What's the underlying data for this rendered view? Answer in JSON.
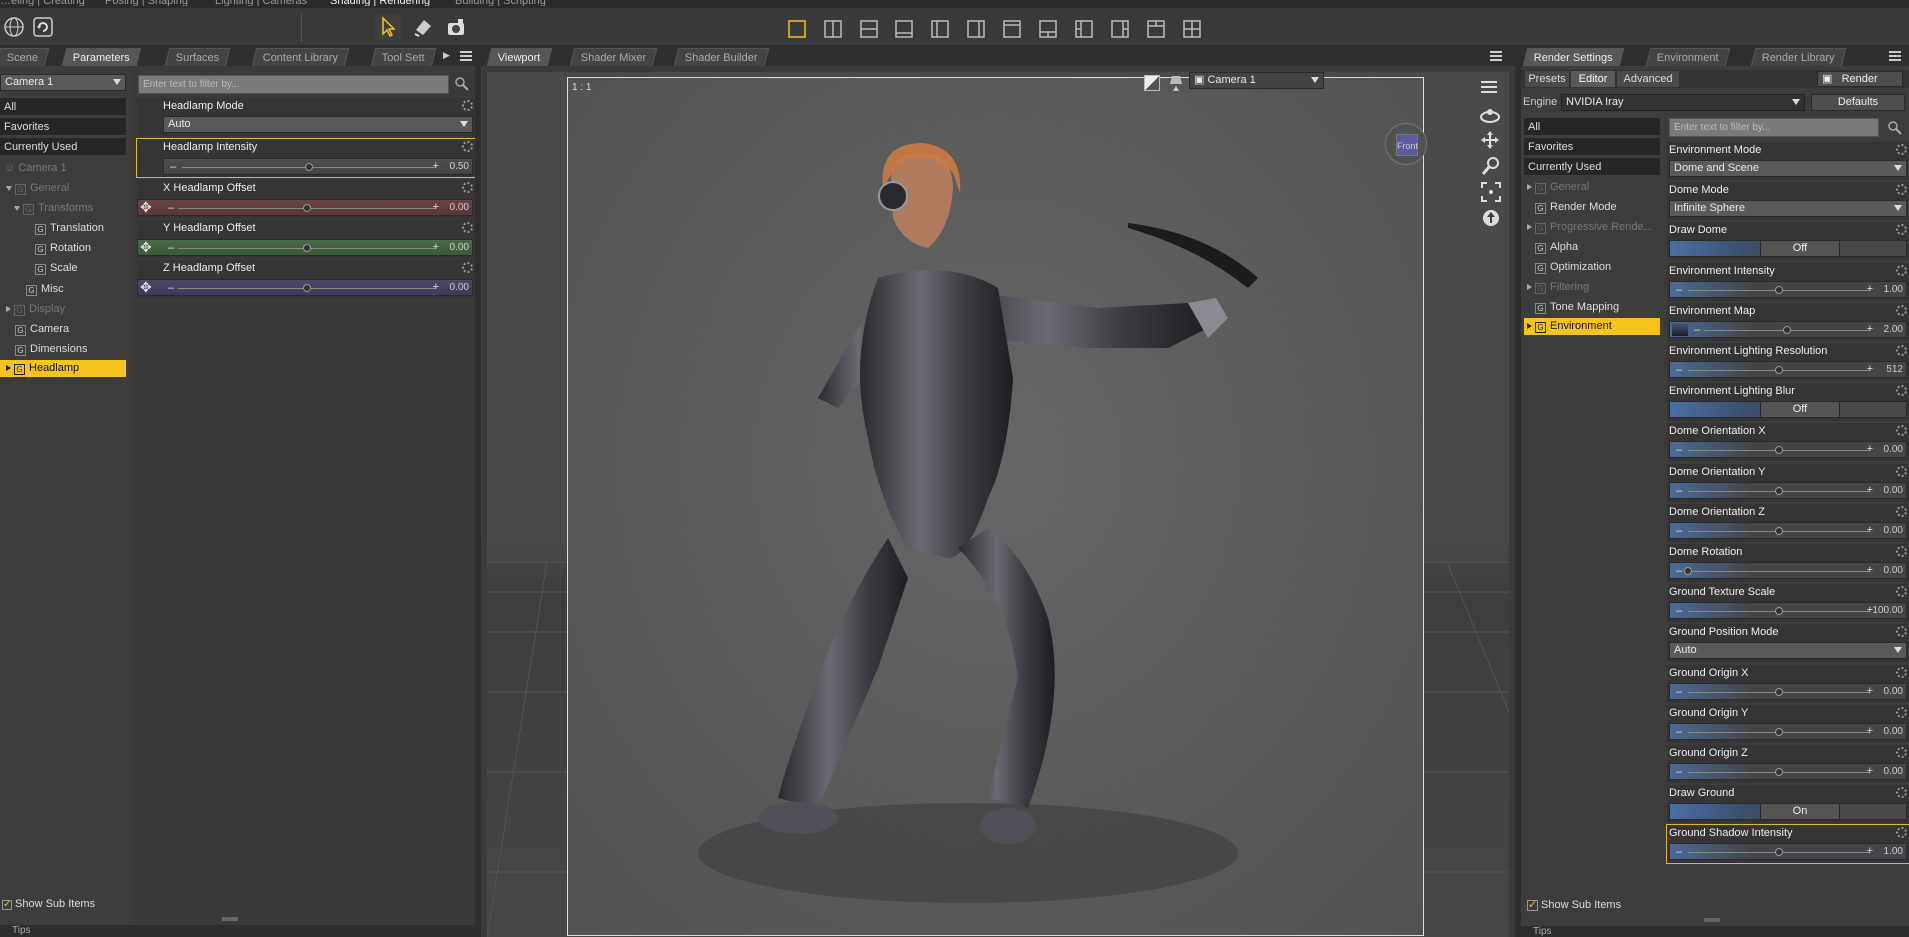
{
  "top_tabs": [
    "…eling | Creating",
    "Posing | Shaping",
    "Lighting | Cameras",
    "Shading | Rendering",
    "Building | Scripting"
  ],
  "left_tabs": [
    "Scene",
    "Parameters",
    "Surfaces",
    "Content Library",
    "Tool Sett"
  ],
  "camera_select": "Camera 1",
  "left_list": [
    "All",
    "Favorites",
    "Currently Used"
  ],
  "tree": [
    {
      "label": "Camera 1",
      "dim": true
    },
    {
      "label": "General",
      "dim": true
    },
    {
      "label": "Transforms",
      "dim": true
    },
    {
      "label": "Translation"
    },
    {
      "label": "Rotation"
    },
    {
      "label": "Scale"
    },
    {
      "label": "Misc"
    },
    {
      "label": "Display",
      "dim": true
    },
    {
      "label": "Camera"
    },
    {
      "label": "Dimensions"
    },
    {
      "label": "Headlamp",
      "selected": true
    }
  ],
  "left_filter_placeholder": "Enter text to filter by...",
  "params": {
    "headlamp_mode": {
      "label": "Headlamp Mode",
      "value": "Auto"
    },
    "headlamp_intensity": {
      "label": "Headlamp Intensity",
      "value": "0.50",
      "level": 0.5
    },
    "x_offset": {
      "label": "X Headlamp Offset",
      "value": "0.00",
      "level": 0.5,
      "color": "#7a4a4a"
    },
    "y_offset": {
      "label": "Y Headlamp Offset",
      "value": "0.00",
      "level": 0.5,
      "color": "#4a6a4a"
    },
    "z_offset": {
      "label": "Z Headlamp Offset",
      "value": "0.00",
      "level": 0.5,
      "color": "#4a4a6a"
    }
  },
  "show_sub_items": "Show Sub Items",
  "tips": "Tips",
  "center_tabs": [
    "Viewport",
    "Shader Mixer",
    "Shader Builder"
  ],
  "viewport": {
    "ratio": "1 : 1",
    "camera": "Camera 1",
    "cube_label": "Front"
  },
  "right_tabs": [
    "Render Settings",
    "Environment",
    "Render Library"
  ],
  "right_subtabs": [
    "Presets",
    "Editor",
    "Advanced"
  ],
  "render_button": "Render",
  "engine_label": "Engine :",
  "engine": "NVIDIA Iray",
  "defaults_button": "Defaults",
  "right_list": [
    "All",
    "Favorites",
    "Currently Used"
  ],
  "right_tree": [
    {
      "label": "General",
      "dim": true,
      "tri": true
    },
    {
      "label": "Render Mode"
    },
    {
      "label": "Progressive Rende...",
      "dim": true,
      "tri": true
    },
    {
      "label": "Alpha"
    },
    {
      "label": "Optimization"
    },
    {
      "label": "Filtering",
      "dim": true,
      "tri": true
    },
    {
      "label": "Tone Mapping"
    },
    {
      "label": "Environment",
      "selected": true,
      "tri": true
    }
  ],
  "right_filter_placeholder": "Enter text to filter by...",
  "env_props": [
    {
      "label": "Environment Mode",
      "type": "dd",
      "value": "Dome and Scene"
    },
    {
      "label": "Dome Mode",
      "type": "dd",
      "value": "Infinite Sphere"
    },
    {
      "label": "Draw Dome",
      "type": "toggle",
      "value": "Off"
    },
    {
      "label": "Environment Intensity",
      "type": "slider",
      "value": "1.00",
      "level": 0.5
    },
    {
      "label": "Environment Map",
      "type": "map",
      "value": "2.00",
      "level": 0.5
    },
    {
      "label": "Environment Lighting Resolution",
      "type": "slider",
      "value": "512",
      "level": 0.5
    },
    {
      "label": "Environment Lighting Blur",
      "type": "toggle",
      "value": "Off"
    },
    {
      "label": "Dome Orientation X",
      "type": "slider",
      "value": "0.00",
      "level": 0.5
    },
    {
      "label": "Dome Orientation Y",
      "type": "slider",
      "value": "0.00",
      "level": 0.5
    },
    {
      "label": "Dome Orientation Z",
      "type": "slider",
      "value": "0.00",
      "level": 0.5
    },
    {
      "label": "Dome Rotation",
      "type": "slider",
      "value": "0.00",
      "level": 0.0
    },
    {
      "label": "Ground Texture Scale",
      "type": "slider",
      "value": "100.00",
      "level": 0.5
    },
    {
      "label": "Ground Position Mode",
      "type": "dd",
      "value": "Auto"
    },
    {
      "label": "Ground Origin X",
      "type": "slider",
      "value": "0.00",
      "level": 0.5
    },
    {
      "label": "Ground Origin Y",
      "type": "slider",
      "value": "0.00",
      "level": 0.5
    },
    {
      "label": "Ground Origin Z",
      "type": "slider",
      "value": "0.00",
      "level": 0.5
    },
    {
      "label": "Draw Ground",
      "type": "toggle",
      "value": "On"
    },
    {
      "label": "Ground Shadow Intensity",
      "type": "slider",
      "value": "1.00",
      "level": 0.5,
      "hl": true
    }
  ],
  "colors": {
    "accent": "#f5c31b",
    "panel": "#3d3d3d",
    "viewport": "#5a5a5a"
  }
}
